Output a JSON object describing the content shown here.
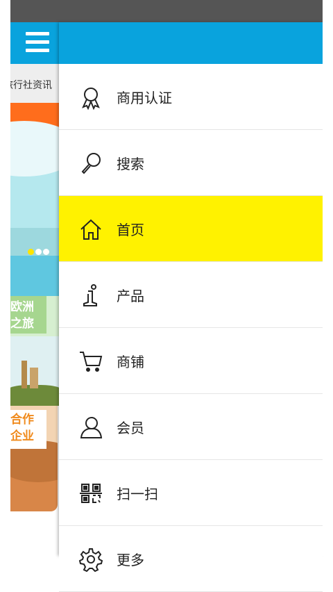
{
  "under_page": {
    "news_label": "旅行社资讯",
    "tiles": [
      {
        "text": "欧洲之旅"
      },
      {
        "text": "合作企业"
      }
    ]
  },
  "drawer": {
    "items": [
      {
        "label": "商用认证",
        "icon": "award-icon",
        "active": false
      },
      {
        "label": "搜索",
        "icon": "search-icon",
        "active": false
      },
      {
        "label": "首页",
        "icon": "home-icon",
        "active": true
      },
      {
        "label": "产品",
        "icon": "info-icon",
        "active": false
      },
      {
        "label": "商铺",
        "icon": "cart-icon",
        "active": false
      },
      {
        "label": "会员",
        "icon": "user-icon",
        "active": false
      },
      {
        "label": "扫一扫",
        "icon": "qr-scan-icon",
        "active": false
      },
      {
        "label": "更多",
        "icon": "gear-icon",
        "active": false
      }
    ]
  },
  "colors": {
    "header": "#09a3dd",
    "active_item": "#fff200",
    "status_bar": "#555555"
  }
}
